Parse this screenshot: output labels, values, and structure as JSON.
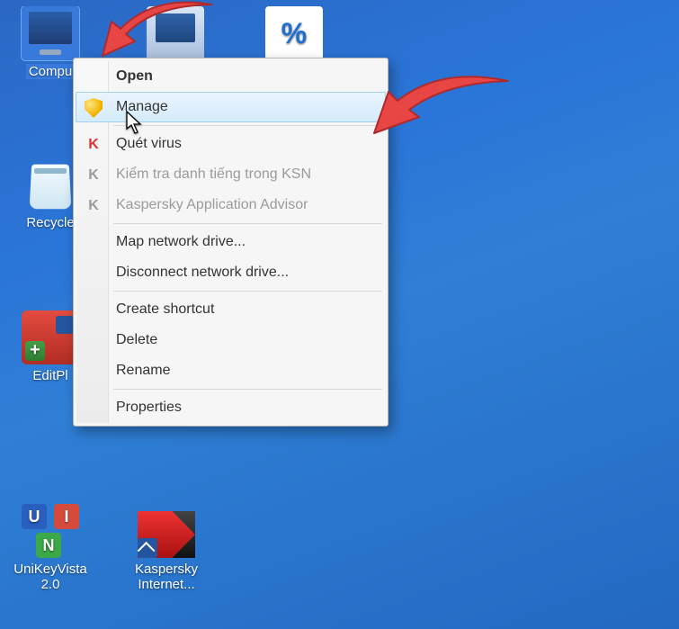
{
  "desktop": {
    "icons": [
      {
        "label": "Compu"
      },
      {
        "label": "Recycle"
      },
      {
        "label": "EditPl"
      },
      {
        "label": "UniKeyVista 2.0"
      },
      {
        "label": "Kaspersky Internet..."
      }
    ],
    "percent_glyph": "℀"
  },
  "context_menu": {
    "open": "Open",
    "manage": "Manage",
    "scan_virus": "Quét virus",
    "ksn_reputation": "Kiểm tra danh tiếng trong KSN",
    "kaspersky_advisor": "Kaspersky Application Advisor",
    "map_drive": "Map network drive...",
    "disconnect_drive": "Disconnect network drive...",
    "create_shortcut": "Create shortcut",
    "delete": "Delete",
    "rename": "Rename",
    "properties": "Properties"
  }
}
